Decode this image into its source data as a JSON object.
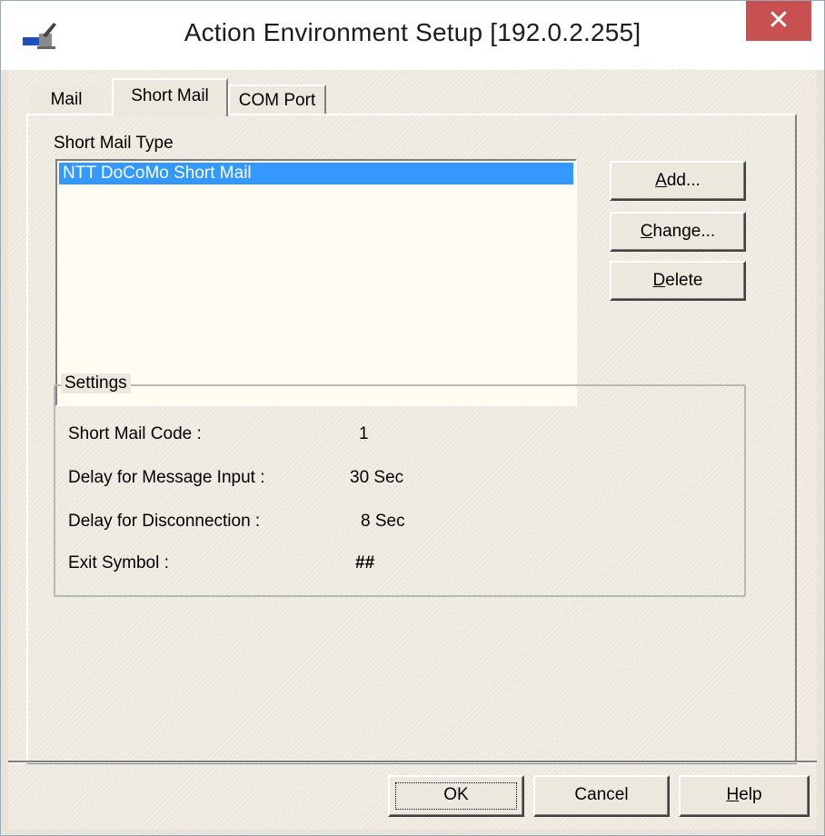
{
  "window": {
    "title": "Action Environment Setup [192.0.2.255]",
    "close_symbol": "✕",
    "app_icon": "env-setup-icon"
  },
  "tabs": [
    {
      "label": "Mail",
      "selected": false
    },
    {
      "label": "Short Mail",
      "selected": true
    },
    {
      "label": "COM Port",
      "selected": false
    }
  ],
  "short_mail": {
    "list_label": "Short Mail Type",
    "items": [
      "NTT DoCoMo Short Mail"
    ],
    "selected_index": 0,
    "buttons": {
      "add": {
        "prefix": "",
        "mnemonic": "A",
        "rest": "dd..."
      },
      "change": {
        "prefix": "",
        "mnemonic": "C",
        "rest": "hange..."
      },
      "delete": {
        "prefix": "",
        "mnemonic": "D",
        "rest": "elete"
      }
    }
  },
  "settings": {
    "title": "Settings",
    "rows": [
      {
        "label": "Short Mail Code :",
        "value": "1"
      },
      {
        "label": "Delay for Message Input :",
        "value": "30 Sec"
      },
      {
        "label": "Delay for Disconnection :",
        "value": "8 Sec"
      },
      {
        "label": "Exit Symbol :",
        "value": "##"
      }
    ]
  },
  "footer": {
    "ok": "OK",
    "cancel": "Cancel",
    "help_mnemonic": "H",
    "help_rest": "elp"
  },
  "colors": {
    "selection": "#3399ff",
    "close_button": "#c75050",
    "dialog_bg": "#ece8dd"
  }
}
